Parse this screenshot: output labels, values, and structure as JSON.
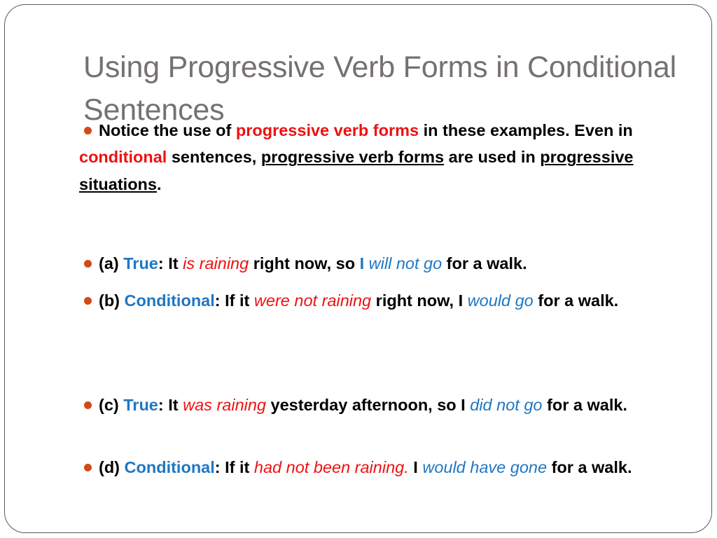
{
  "slide": {
    "title": "Using Progressive Verb Forms in Conditional Sentences",
    "bullet_glyph": "•",
    "colors": {
      "title_gray": "#767171",
      "bullet_orange": "#D14A18",
      "accent_red": "#EE1111",
      "accent_blue": "#1F77C4",
      "body_black": "#000000",
      "border_gray": "#5A5A5A",
      "background": "#FFFFFF"
    },
    "intro": {
      "seg1": "Notice the use of ",
      "seg2_red": "progressive verb forms",
      "seg3": " in these examples. Even in ",
      "seg4_red": "conditional",
      "seg5": " sentences, ",
      "seg6_underline": "progressive verb forms",
      "seg7": " are used in ",
      "seg8_underline": "progressive situations",
      "seg9": "."
    },
    "examples": [
      {
        "id": "a",
        "label": "(a) ",
        "type": "True",
        "type_color": "blue",
        "colon": ": ",
        "pre": "It ",
        "verb_red": "is raining",
        "mid": " right now, so ",
        "subject": "I",
        "verb_blue": " will not go",
        "post": " for a walk."
      },
      {
        "id": "b",
        "label": "(b) ",
        "type": "Conditional",
        "type_color": "blue",
        "colon": ": ",
        "pre": "If it ",
        "verb_red": "were not raining",
        "mid": " right now, I ",
        "subject": "",
        "verb_blue": "would go",
        "post": " for a walk."
      },
      {
        "id": "c",
        "label": "(c) ",
        "type": "True",
        "type_color": "blue",
        "colon": ": ",
        "pre": "It ",
        "verb_red": "was raining",
        "mid": " yesterday afternoon, so I ",
        "subject": "",
        "verb_blue": "did not go",
        "post": " for a walk."
      },
      {
        "id": "d",
        "label": "(d) ",
        "type": "Conditional",
        "type_color": "blue",
        "colon": ": ",
        "pre": "If it ",
        "verb_red": "had not been raining.",
        "mid": " I ",
        "subject": "",
        "verb_blue": "would have gone",
        "post": " for a walk."
      }
    ]
  }
}
